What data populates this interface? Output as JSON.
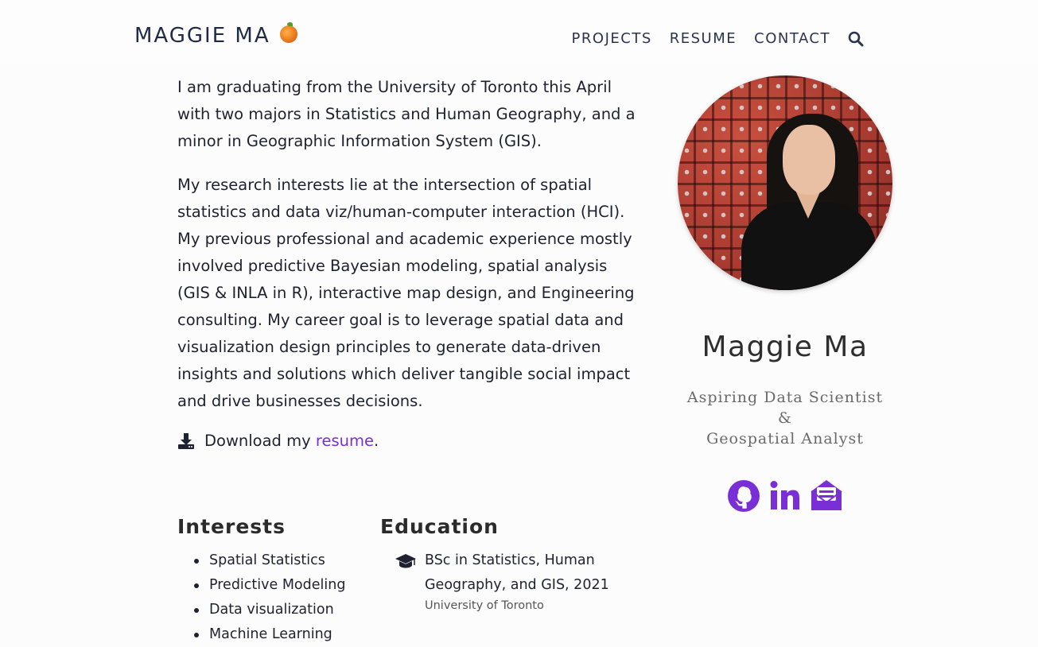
{
  "nav": {
    "brand": "MAGGIE MA",
    "brand_icon": "orange-icon",
    "links": [
      "PROJECTS",
      "RESUME",
      "CONTACT"
    ],
    "search_icon": "search-icon"
  },
  "about": {
    "para1": "I am graduating from the University of Toronto this April with two majors in Statistics and Human Geography, and a minor in Geographic Information System (GIS).",
    "para2": "My research interests lie at the intersection of spatial statistics and data viz/human-computer interaction (HCI). My previous professional and academic experience mostly involved predictive Bayesian modeling, spatial analysis (GIS & INLA in R), interactive map design, and Engineering consulting. My career goal is to leverage spatial data and visualization design principles to generate data-driven insights and solutions which deliver tangible social impact and drive businesses decisions.",
    "download_prefix": "Download my",
    "download_link": "resume",
    "download_suffix": "."
  },
  "interests": {
    "title": "Interests",
    "items": [
      "Spatial Statistics",
      "Predictive Modeling",
      "Data visualization",
      "Machine Learning"
    ]
  },
  "education": {
    "title": "Education",
    "degree": "BSc in Statistics, Human Geography, and GIS, 2021",
    "school": "University of Toronto"
  },
  "profile": {
    "name": "Maggie Ma",
    "tagline_line1": "Aspiring Data Scientist &",
    "tagline_line2": "Geospatial Analyst",
    "social_icons": [
      "github-icon",
      "linkedin-icon",
      "email-icon"
    ]
  },
  "colors": {
    "accent": "#7a2fd6",
    "navy": "#1f2a44"
  }
}
